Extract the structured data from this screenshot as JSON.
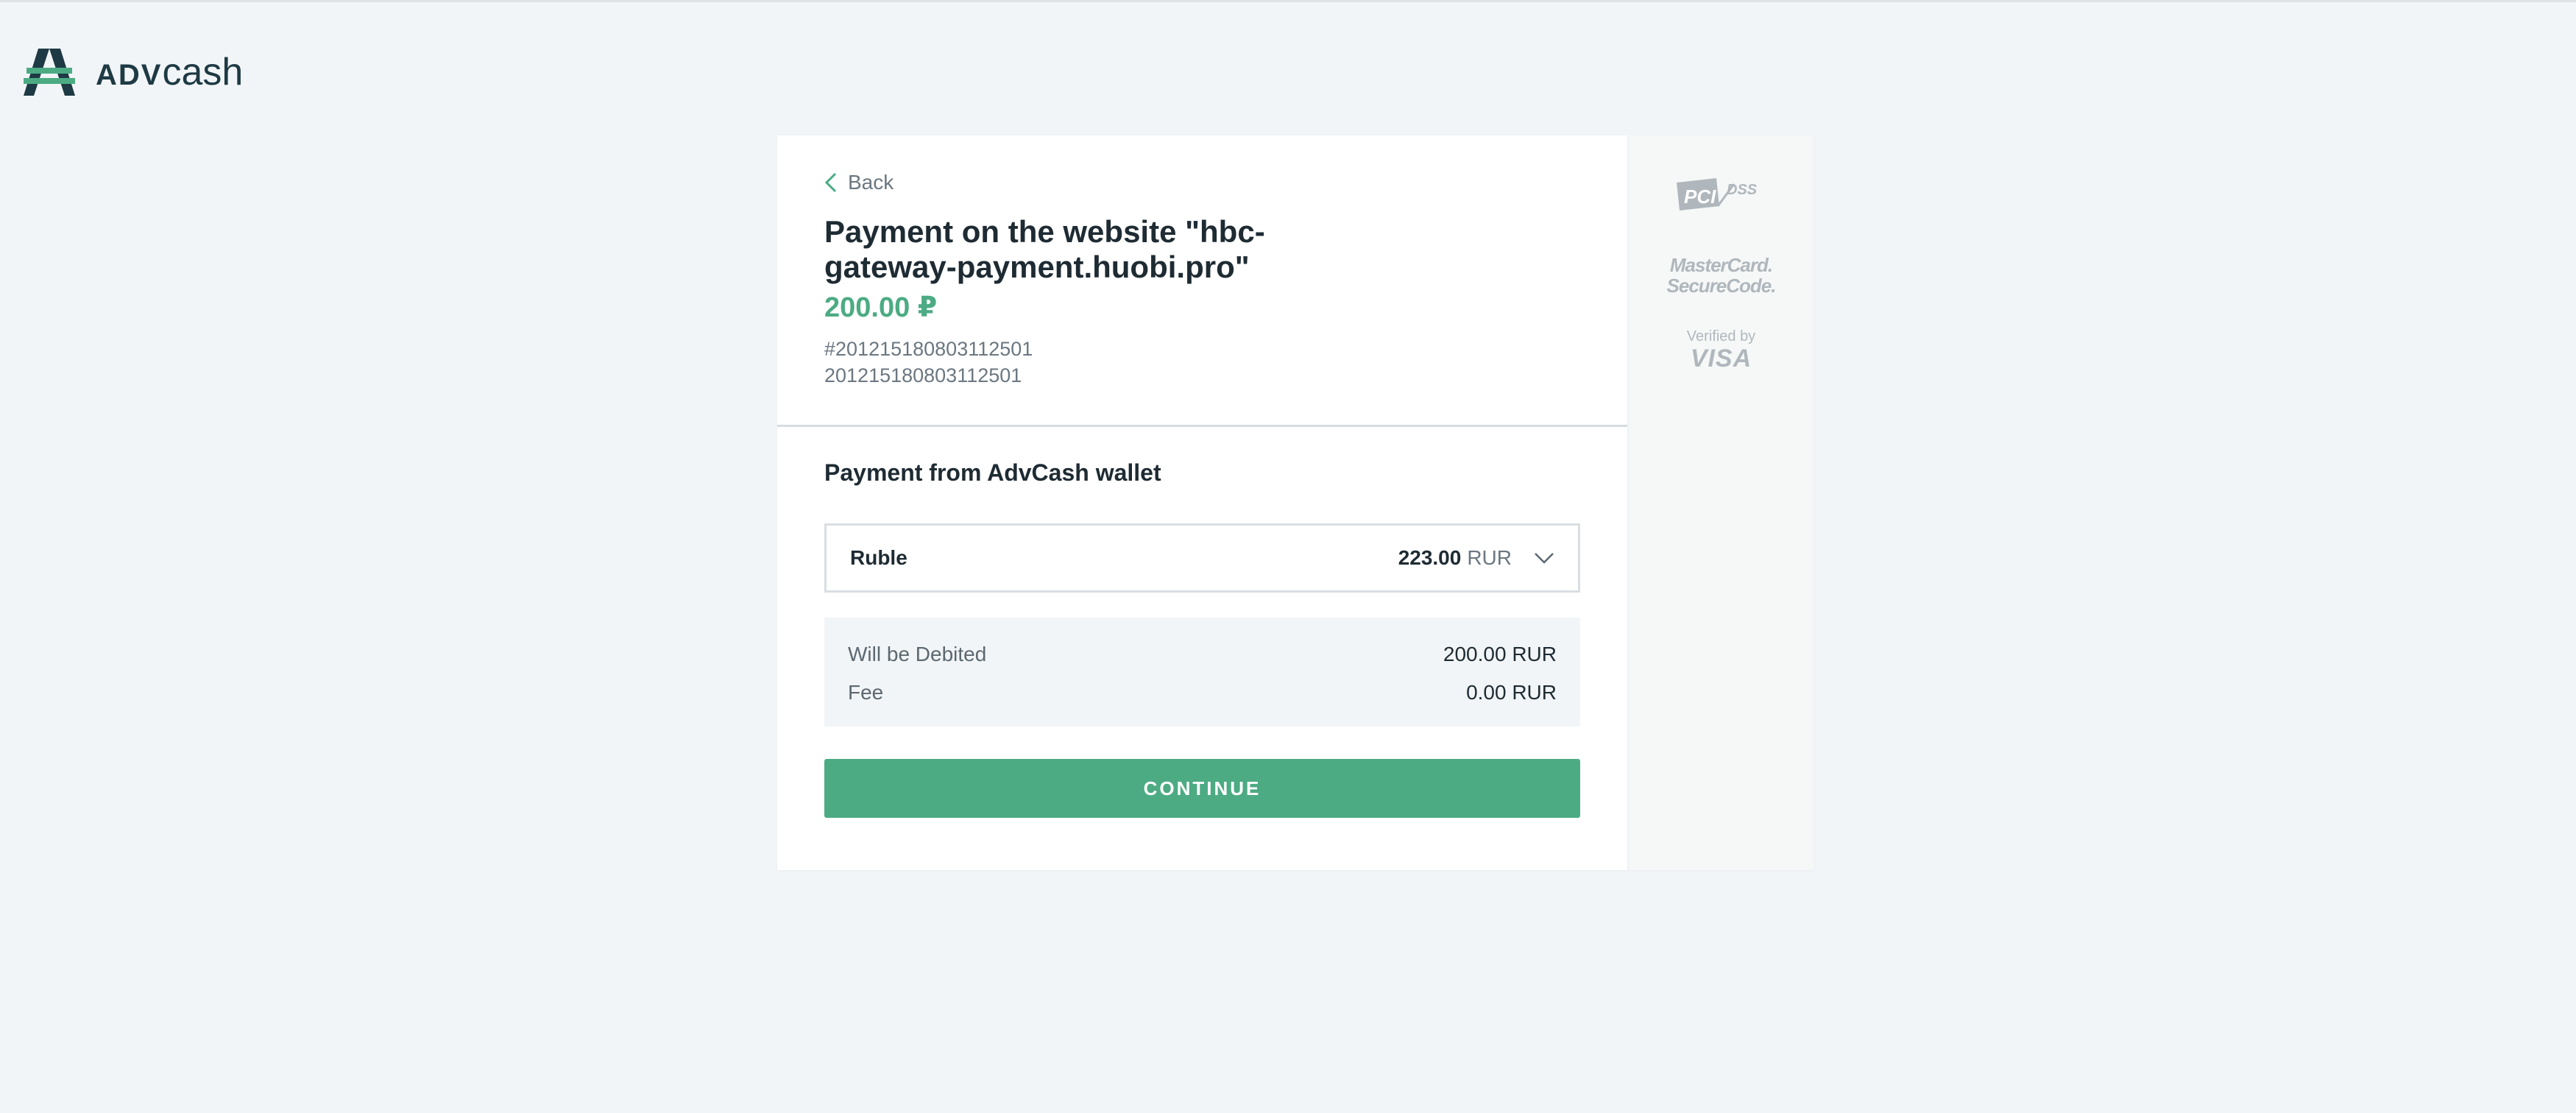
{
  "brand": {
    "logo_adv": "ADV",
    "logo_cash": "cash",
    "accent_color": "#4cab83"
  },
  "payment": {
    "back_label": "Back",
    "title": "Payment on the website \"hbc-gateway-payment.huobi.pro\"",
    "amount": "200.00 ₽",
    "order_id": "#201215180803112501",
    "order_description": "201215180803112501"
  },
  "wallet": {
    "section_title": "Payment from AdvCash wallet",
    "selected_name": "Ruble",
    "selected_balance": "223.00",
    "selected_currency": "RUR"
  },
  "summary": {
    "debited_label": "Will be Debited",
    "debited_value": "200.00 RUR",
    "fee_label": "Fee",
    "fee_value": "0.00 RUR"
  },
  "actions": {
    "continue_label": "CONTINUE"
  },
  "security_badges": {
    "pci_text": "PCI",
    "pci_dss": "DSS",
    "mastercard_line1": "MasterCard.",
    "mastercard_line2": "SecureCode.",
    "visa_line1": "Verified by",
    "visa_line2": "VISA"
  }
}
